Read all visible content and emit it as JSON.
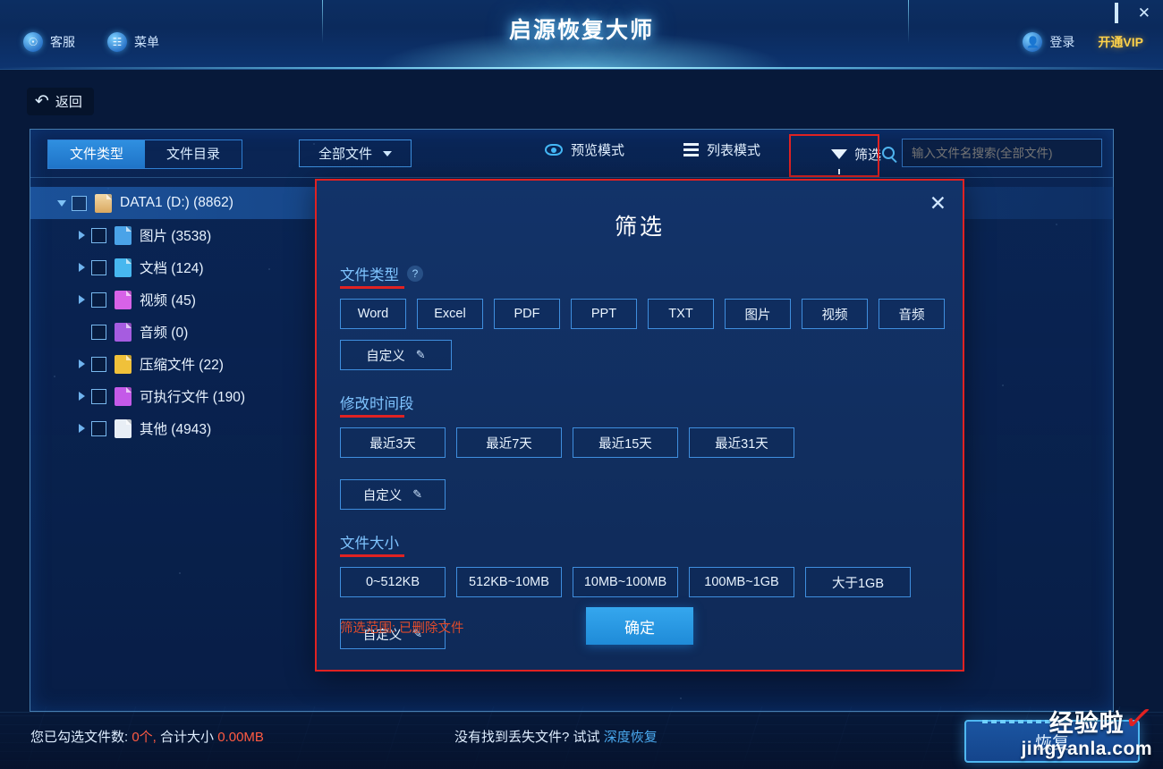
{
  "window": {
    "title": "启源恢复大师",
    "controls": {
      "minimize": "–",
      "maximize": "□",
      "close": "✕"
    }
  },
  "titlebar": {
    "left_items": [
      {
        "label": "客服",
        "icon": "headset-icon"
      },
      {
        "label": "菜单",
        "icon": "grid-menu-icon"
      }
    ],
    "login_label": "登录",
    "vip_label": "开通VIP"
  },
  "back_button": {
    "label": "返回",
    "icon": "back-arrow-icon"
  },
  "toolbar": {
    "tabs": [
      {
        "label": "文件类型",
        "active": true
      },
      {
        "label": "文件目录",
        "active": false
      }
    ],
    "dropdown": {
      "value": "全部文件"
    },
    "preview_mode": "预览模式",
    "list_mode": "列表模式",
    "filter": "筛选",
    "search": {
      "placeholder": "输入文件名搜索(全部文件)",
      "value": ""
    }
  },
  "tree": {
    "root": {
      "label": "DATA1 (D:) (8862)",
      "icon": "drive-icon",
      "expanded": true,
      "checked": false
    },
    "children": [
      {
        "label": "图片 (3538)",
        "icon": "image-file-icon",
        "color": "#4aa3e8",
        "has_children": true
      },
      {
        "label": "文档 (124)",
        "icon": "document-file-icon",
        "color": "#47b7ef",
        "has_children": true
      },
      {
        "label": "视频 (45)",
        "icon": "video-file-icon",
        "color": "#d762e8",
        "has_children": true
      },
      {
        "label": "音频 (0)",
        "icon": "audio-file-icon",
        "color": "#a65ce0",
        "has_children": false
      },
      {
        "label": "压缩文件 (22)",
        "icon": "archive-file-icon",
        "color": "#f0c13a",
        "has_children": true
      },
      {
        "label": "可执行文件 (190)",
        "icon": "executable-file-icon",
        "color": "#c45ae8",
        "has_children": true
      },
      {
        "label": "其他 (4943)",
        "icon": "other-file-icon",
        "color": "#e8eef5",
        "has_children": true
      }
    ]
  },
  "modal": {
    "title": "筛选",
    "close_icon": "close-icon",
    "sections": [
      {
        "heading": "文件类型",
        "has_help": true,
        "help_icon": "question-mark-icon",
        "chips": [
          {
            "label": "Word",
            "size": "w74"
          },
          {
            "label": "Excel",
            "size": "w74"
          },
          {
            "label": "PDF",
            "size": "w74"
          },
          {
            "label": "PPT",
            "size": "w74"
          },
          {
            "label": "TXT",
            "size": "w74"
          },
          {
            "label": "图片",
            "size": "w74"
          },
          {
            "label": "视频",
            "size": "w74"
          },
          {
            "label": "音频",
            "size": "w74"
          },
          {
            "label": "自定义",
            "size": "w125",
            "pencil": "✎"
          }
        ]
      },
      {
        "heading": "修改时间段",
        "has_help": false,
        "chips": [
          {
            "label": "最近3天",
            "size": "w110"
          },
          {
            "label": "最近7天",
            "size": "w110"
          },
          {
            "label": "最近15天",
            "size": "w110"
          },
          {
            "label": "最近31天",
            "size": "w110"
          },
          {
            "label": "自定义",
            "size": "w110",
            "pencil": "✎",
            "newline": true
          }
        ]
      },
      {
        "heading": "文件大小",
        "has_help": false,
        "chips": [
          {
            "label": "0~512KB",
            "size": "w110"
          },
          {
            "label": "512KB~10MB",
            "size": "w110"
          },
          {
            "label": "10MB~100MB",
            "size": "w110"
          },
          {
            "label": "100MB~1GB",
            "size": "w110"
          },
          {
            "label": "大于1GB",
            "size": "w110"
          },
          {
            "label": "自定义",
            "size": "w110",
            "pencil": "✎",
            "newline": true
          }
        ]
      }
    ],
    "scope_text": "筛选范围: 已删除文件",
    "confirm_label": "确定"
  },
  "statusbar": {
    "selected_prefix": "您已勾选文件数:",
    "selected_count": "0个,",
    "size_label": "合计大小",
    "size_value": "0.00MB",
    "hint_text": "没有找到丢失文件? 试试",
    "hint_link": "深度恢复",
    "recover_label": "恢复"
  },
  "watermark": {
    "line1": "经验啦",
    "line2": "jingyanla.com",
    "check": "✓"
  },
  "colors": {
    "accent_blue": "#2f8fe0",
    "highlight_red": "#e02222",
    "link_blue": "#4aa9ef",
    "vip_gold": "#ffd24a",
    "scope_red": "#e04b2b"
  }
}
